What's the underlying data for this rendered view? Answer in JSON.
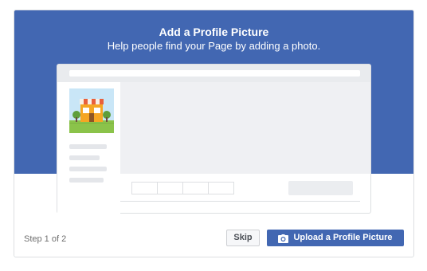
{
  "dialog": {
    "title": "Add a Profile Picture",
    "subtitle": "Help people find your Page by adding a photo."
  },
  "footer": {
    "step_text": "Step 1 of 2",
    "skip_label": "Skip",
    "upload_label": "Upload a Profile Picture",
    "upload_icon": "camera-icon"
  },
  "colors": {
    "banner": "#4267b2",
    "primary_button": "#4267b2"
  }
}
